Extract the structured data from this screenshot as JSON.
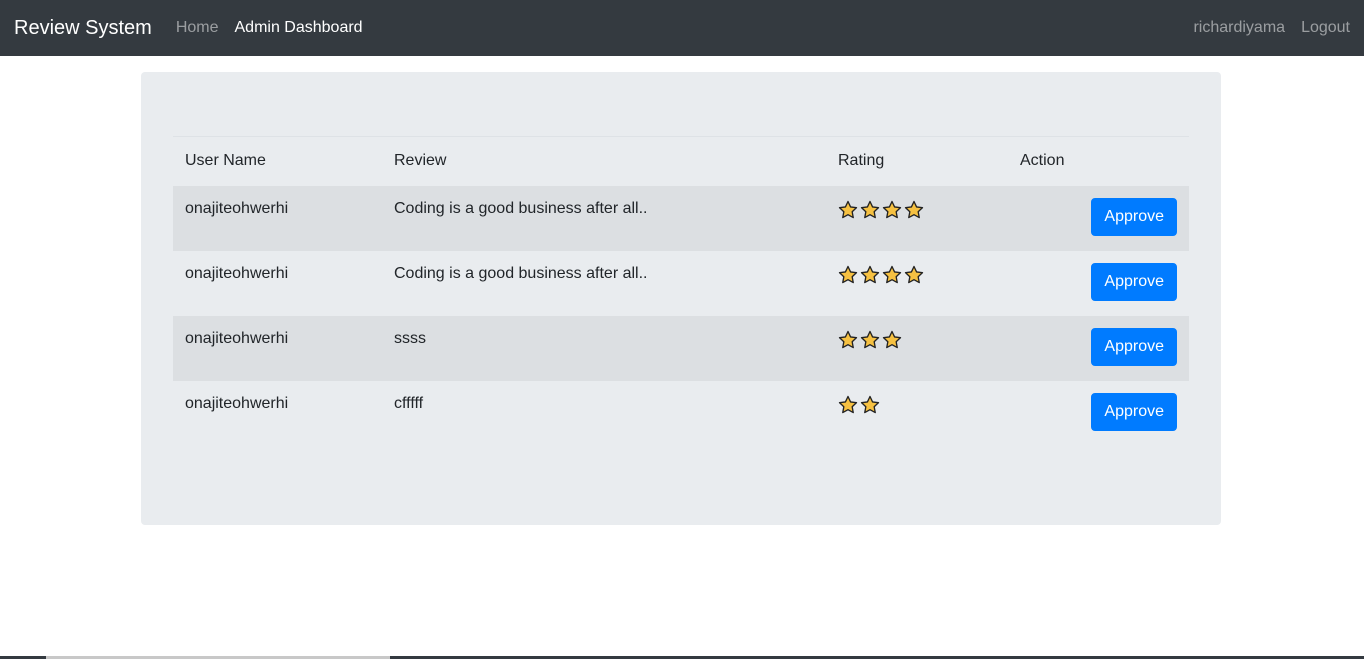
{
  "navbar": {
    "brand": "Review System",
    "links": [
      {
        "label": "Home"
      },
      {
        "label": "Admin Dashboard"
      }
    ],
    "user": "richardiyama",
    "logout": "Logout"
  },
  "table": {
    "headers": [
      "User Name",
      "Review",
      "Rating",
      "Action"
    ],
    "rows": [
      {
        "user": "onajiteohwerhi",
        "review": "Coding is a good business after all..",
        "rating": 4,
        "action": "Approve"
      },
      {
        "user": "onajiteohwerhi",
        "review": "Coding is a good business after all..",
        "rating": 4,
        "action": "Approve"
      },
      {
        "user": "onajiteohwerhi",
        "review": "ssss",
        "rating": 3,
        "action": "Approve"
      },
      {
        "user": "onajiteohwerhi",
        "review": "cfffff",
        "rating": 2,
        "action": "Approve"
      }
    ]
  },
  "colors": {
    "navbar": "#343a40",
    "primary": "#007bff",
    "card": "#e9ecef",
    "star_fill": "#f6c142",
    "star_stroke": "#222222"
  },
  "icons": {
    "rating": "star-icon"
  }
}
